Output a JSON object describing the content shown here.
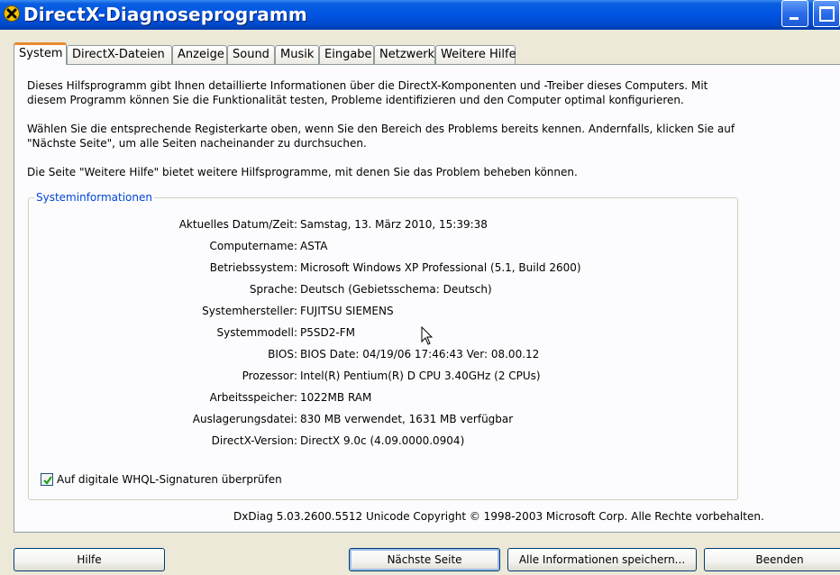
{
  "window": {
    "title": "DirectX-Diagnoseprogramm",
    "icon": "directx-icon"
  },
  "tabs": [
    {
      "label": "System",
      "active": true
    },
    {
      "label": "DirectX-Dateien",
      "active": false
    },
    {
      "label": "Anzeige",
      "active": false
    },
    {
      "label": "Sound",
      "active": false
    },
    {
      "label": "Musik",
      "active": false
    },
    {
      "label": "Eingabe",
      "active": false
    },
    {
      "label": "Netzwerk",
      "active": false
    },
    {
      "label": "Weitere Hilfe",
      "active": false
    }
  ],
  "intro": {
    "p1": "Dieses Hilfsprogramm gibt Ihnen detaillierte Informationen über die DirectX-Komponenten und -Treiber dieses Computers. Mit diesem Programm können Sie die Funktionalität testen, Probleme identifizieren und den Computer optimal konfigurieren.",
    "p2": "Wählen Sie die entsprechende Registerkarte oben, wenn Sie den Bereich des Problems bereits kennen. Andernfalls, klicken Sie auf \"Nächste Seite\", um alle Seiten nacheinander zu durchsuchen.",
    "p3": "Die Seite \"Weitere Hilfe\" bietet weitere Hilfsprogramme, mit denen Sie das Problem beheben können."
  },
  "system_info": {
    "group_label": "Systeminformationen",
    "rows": [
      {
        "label": "Aktuelles Datum/Zeit:",
        "value": "Samstag, 13. März 2010, 15:39:38"
      },
      {
        "label": "Computername:",
        "value": "ASTA"
      },
      {
        "label": "Betriebssystem:",
        "value": "Microsoft Windows XP Professional (5.1, Build 2600)"
      },
      {
        "label": "Sprache:",
        "value": "Deutsch (Gebietsschema: Deutsch)"
      },
      {
        "label": "Systemhersteller:",
        "value": "FUJITSU SIEMENS"
      },
      {
        "label": "Systemmodell:",
        "value": "P5SD2-FM"
      },
      {
        "label": "BIOS:",
        "value": "BIOS Date: 04/19/06 17:46:43 Ver: 08.00.12"
      },
      {
        "label": "Prozessor:",
        "value": "Intel(R) Pentium(R) D CPU 3.40GHz (2 CPUs)"
      },
      {
        "label": "Arbeitsspeicher:",
        "value": "1022MB RAM"
      },
      {
        "label": "Auslagerungsdatei:",
        "value": "830 MB verwendet, 1631 MB verfügbar"
      },
      {
        "label": "DirectX-Version:",
        "value": "DirectX 9.0c (4.09.0000.0904)"
      }
    ],
    "whql_checkbox": {
      "label": "Auf  digitale WHQL-Signaturen überprüfen",
      "checked": true
    }
  },
  "copyright": "DxDiag 5.03.2600.5512 Unicode  Copyright © 1998-2003 Microsoft Corp. Alle Rechte vorbehalten.",
  "buttons": {
    "help": "Hilfe",
    "next": "Nächste Seite",
    "save_all": "Alle Informationen speichern...",
    "quit": "Beenden"
  },
  "colors": {
    "titlebar": "#0054e3",
    "active_tab_accent": "#e68b2c",
    "group_label": "#0046d5",
    "dialog_bg": "#ece9d8"
  }
}
